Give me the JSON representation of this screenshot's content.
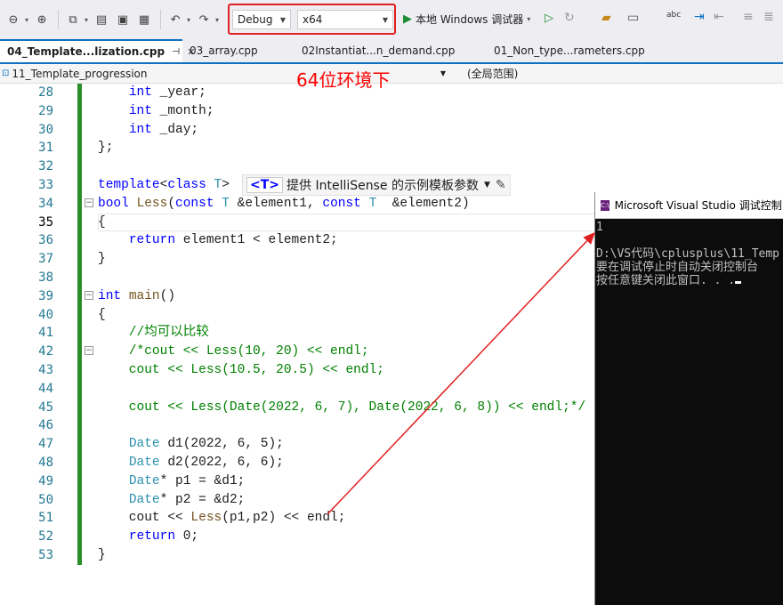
{
  "toolbar": {
    "config": "Debug",
    "platform": "x64",
    "run_label": "本地 Windows 调试器"
  },
  "tabs": [
    {
      "label": "04_Template...lization.cpp",
      "active": true
    },
    {
      "label": "03_array.cpp",
      "active": false
    },
    {
      "label": "02Instantiat...n_demand.cpp",
      "active": false
    },
    {
      "label": "01_Non_type...rameters.cpp",
      "active": false
    }
  ],
  "navbar": {
    "project": "11_Template_progression",
    "scope": "(全局范围)"
  },
  "annotation": "64位环境下",
  "intellisense": {
    "param": "<T>",
    "text": "提供 IntelliSense 的示例模板参数"
  },
  "editor": {
    "line_numbers": [
      "28",
      "29",
      "30",
      "31",
      "32",
      "33",
      "34",
      "35",
      "36",
      "37",
      "38",
      "39",
      "40",
      "41",
      "42",
      "43",
      "44",
      "45",
      "46",
      "47",
      "48",
      "49",
      "50",
      "51",
      "52",
      "53"
    ],
    "current_line": "35"
  },
  "console": {
    "title": "Microsoft Visual Studio 调试控制台",
    "lines": [
      "1",
      "",
      "D:\\VS代码\\cplusplus\\11_Temp",
      "要在调试停止时自动关闭控制台",
      "按任意键关闭此窗口. . ."
    ]
  }
}
